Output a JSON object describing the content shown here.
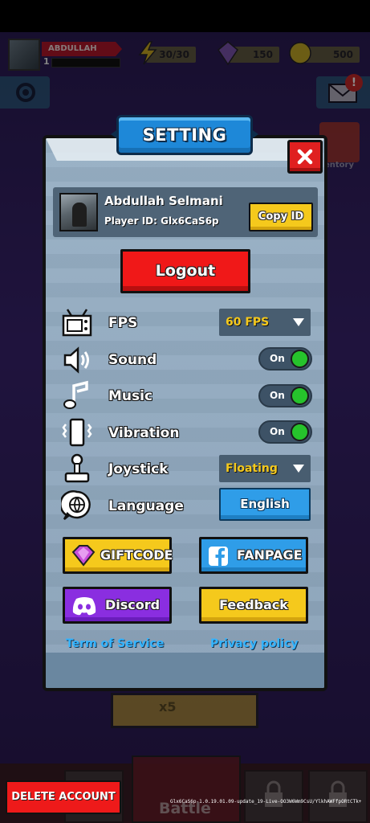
{
  "hud": {
    "player_name": "ABDULLAH SELMANI",
    "level": "1",
    "energy": "30/30",
    "gems": "150",
    "coins": "500",
    "mail_badge": "!",
    "inventory_label": "entory"
  },
  "dialog": {
    "title": "SETTING",
    "profile": {
      "name": "Abdullah Selmani",
      "player_id": "Player ID: Glx6CaS6p",
      "copy_label": "Copy ID"
    },
    "logout_label": "Logout",
    "rows": {
      "fps": {
        "label": "FPS",
        "value": "60 FPS",
        "icon": "tv-icon"
      },
      "sound": {
        "label": "Sound",
        "value": "On",
        "icon": "speaker-icon"
      },
      "music": {
        "label": "Music",
        "value": "On",
        "icon": "music-note-icon"
      },
      "vibration": {
        "label": "Vibration",
        "value": "On",
        "icon": "vibration-icon"
      },
      "joystick": {
        "label": "Joystick",
        "value": "Floating",
        "icon": "joystick-icon"
      },
      "language": {
        "label": "Language",
        "value": "English",
        "icon": "globe-icon"
      }
    },
    "buttons": {
      "giftcode": "GIFTCODE",
      "fanpage": "FANPAGE",
      "discord": "Discord",
      "feedback": "Feedback"
    },
    "links": {
      "terms": "Term of Service",
      "privacy": "Privacy policy"
    }
  },
  "bottom": {
    "event_multiplier": "x5",
    "battle_label": "Battle",
    "delete_account": "DELETE ACCOUNT",
    "build_info": "Glx6CaS6p-1.0.19.01.09-update_19-Live-OO3W6Wm9CsU/YlkhAWFfpORtCTk+"
  },
  "colors": {
    "accent_red": "#f01818",
    "accent_yellow": "#f5c91c",
    "accent_blue": "#2f9de8",
    "accent_purple": "#8a2ee0",
    "toggle_on": "#26c32c",
    "link": "#34b4ff"
  }
}
